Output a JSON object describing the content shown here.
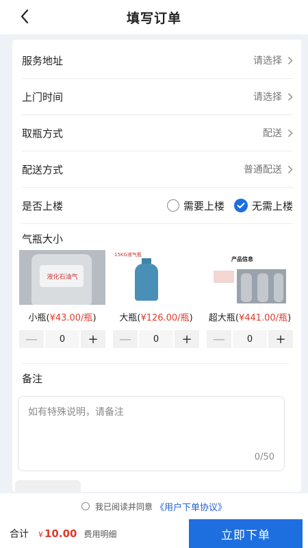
{
  "header": {
    "title": "填写订单"
  },
  "rows": [
    {
      "label": "服务地址",
      "value": "请选择"
    },
    {
      "label": "上门时间",
      "value": "请选择"
    },
    {
      "label": "取瓶方式",
      "value": "配送"
    },
    {
      "label": "配送方式",
      "value": "普通配送"
    }
  ],
  "upstairs": {
    "label": "是否上楼",
    "options": [
      {
        "label": "需要上楼",
        "checked": false
      },
      {
        "label": "无需上楼",
        "checked": true
      }
    ]
  },
  "cylinder_section": {
    "title": "气瓶大小"
  },
  "cylinders": [
    {
      "name": "小瓶",
      "price": "¥43.00/瓶",
      "qty": "0",
      "minus": "—",
      "plus": "+",
      "image_text": "液化石油气"
    },
    {
      "name": "大瓶",
      "price": "¥126.00/瓶",
      "qty": "0",
      "minus": "—",
      "plus": "+",
      "image_text": "15KG液气瓶"
    },
    {
      "name": "超大瓶",
      "price": "¥441.00/瓶",
      "qty": "0",
      "minus": "—",
      "plus": "+",
      "image_text": "产品信息"
    }
  ],
  "remark": {
    "title": "备注",
    "placeholder": "如有特殊说明，请备注",
    "count": "0/50"
  },
  "agreement": {
    "text": "我已阅读并同意",
    "link": "《用户下单协议》"
  },
  "footer": {
    "total_label": "合计",
    "currency": "¥",
    "amount": "10.00",
    "fee_detail": "费用明细",
    "submit": "立即下单"
  },
  "colors": {
    "accent": "#1d6fe0",
    "price": "#e03a2b"
  }
}
